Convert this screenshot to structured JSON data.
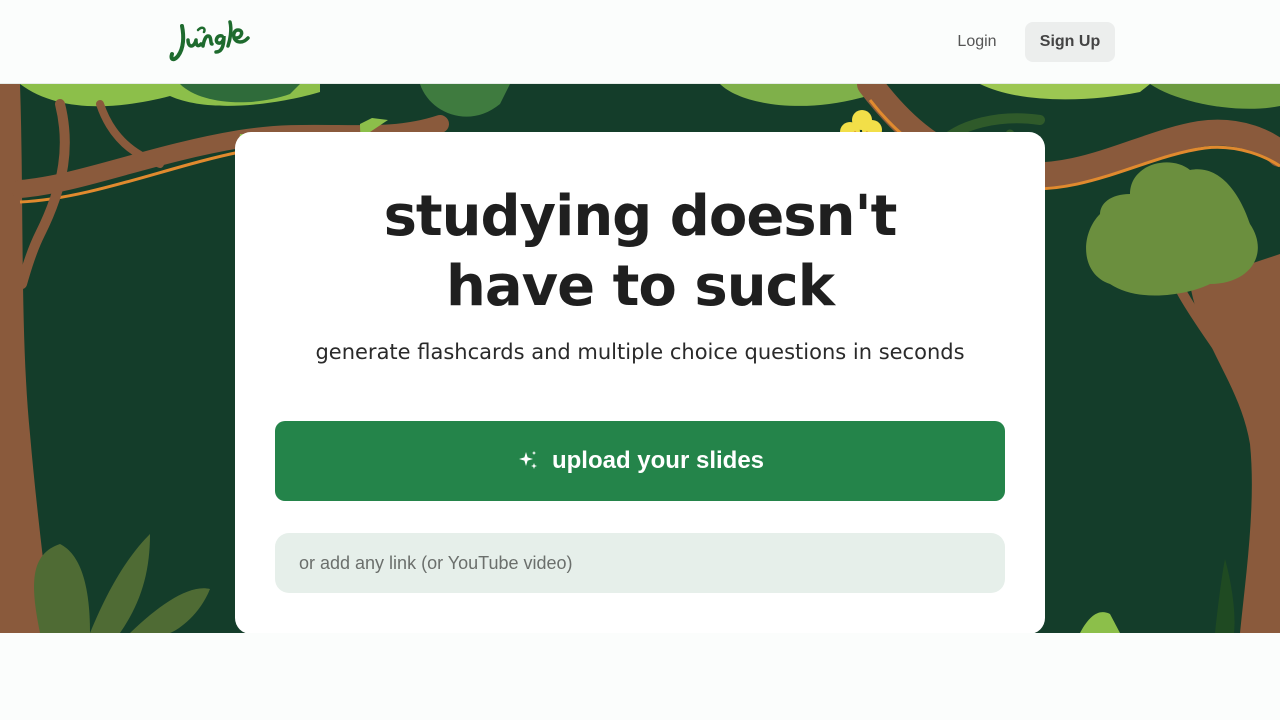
{
  "header": {
    "logo_alt": "Jungle",
    "login_label": "Login",
    "signup_label": "Sign Up"
  },
  "hero": {
    "headline_line1": "studying doesn't",
    "headline_line2": "have to suck",
    "subheadline": "generate flashcards and multiple choice questions in seconds",
    "upload_label": "upload your slides",
    "upload_icon": "sparkles-icon",
    "link_placeholder": "or add any link (or YouTube video)",
    "link_value": ""
  },
  "colors": {
    "accent": "#24844a",
    "jungle_bg": "#143d2a",
    "input_bg": "#e6efea",
    "brand_logo": "#1e6b2e"
  }
}
